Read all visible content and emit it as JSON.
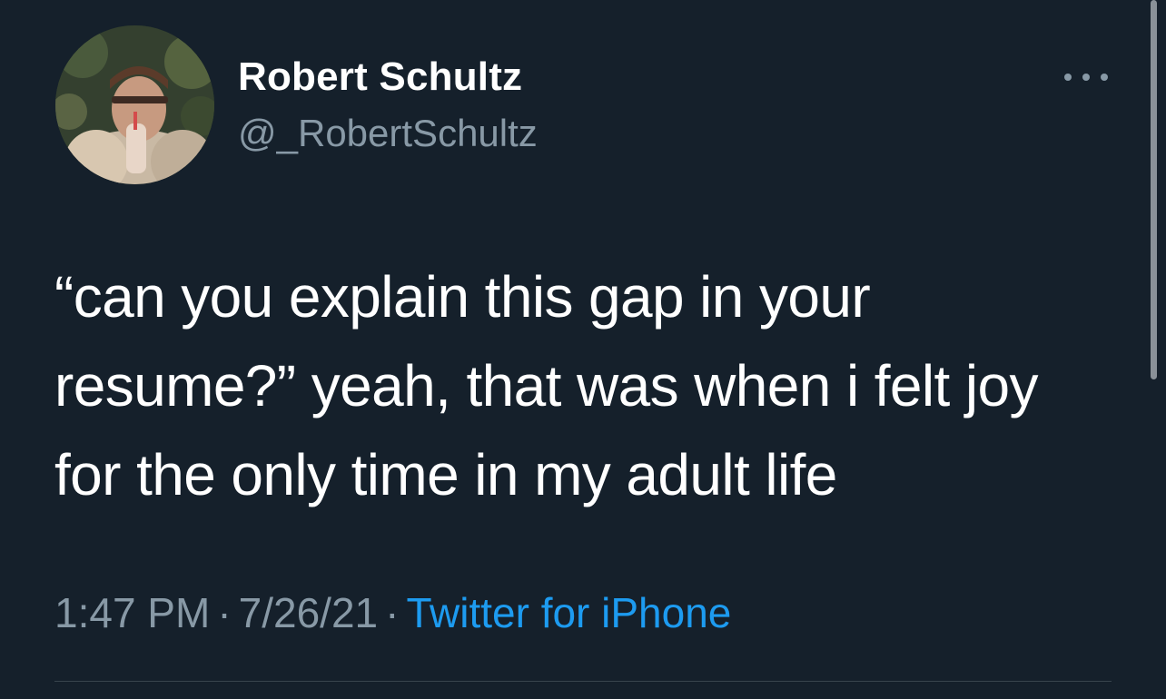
{
  "tweet": {
    "author": {
      "display_name": "Robert Schultz",
      "handle": "@_RobertSchultz",
      "avatar_icon": "profile-photo"
    },
    "more_icon": "more-horizontal-icon",
    "text_lines": [
      "“can you explain this gap in your",
      "resume?” yeah, that was when i felt joy",
      "for the only time in my adult life"
    ],
    "meta": {
      "time": "1:47 PM",
      "separator": "·",
      "date": "7/26/21",
      "source": "Twitter for iPhone"
    }
  },
  "colors": {
    "background": "#15202b",
    "text_primary": "#ffffff",
    "text_secondary": "#8899a6",
    "link": "#1d9bf0",
    "divider": "#38444d"
  }
}
